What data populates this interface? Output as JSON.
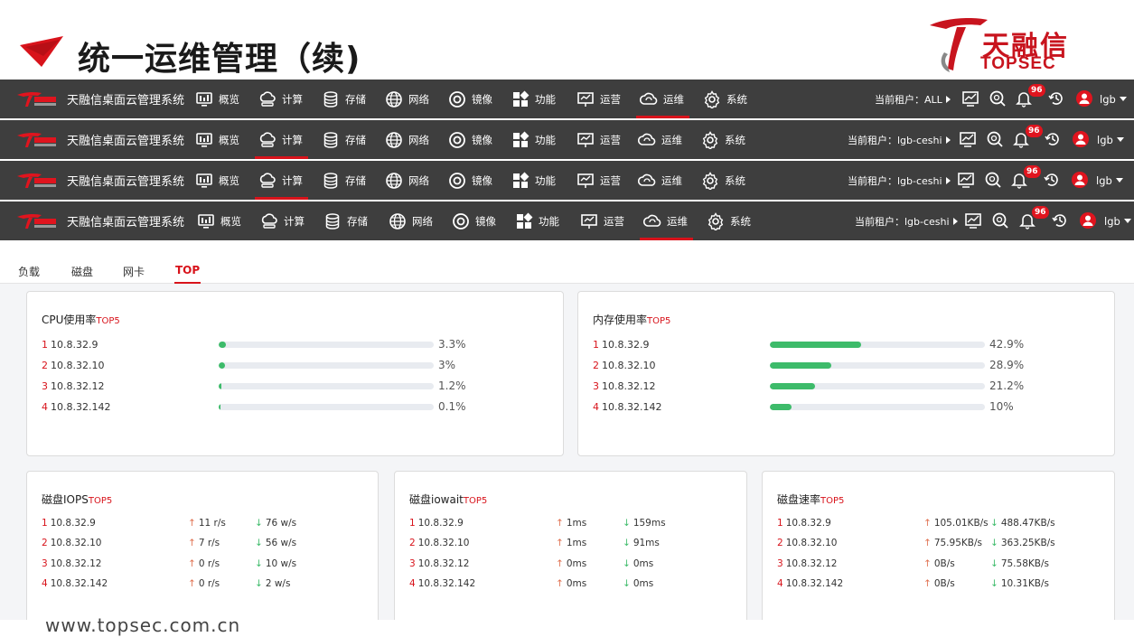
{
  "slide": {
    "title": "统一运维管理（续)",
    "footer_url": "www.topsec.com.cn"
  },
  "logo": {
    "cn": "天融信",
    "en": "TOPSEC"
  },
  "colors": {
    "brand_red": "#d8131b",
    "navbar_bg": "#3e3e3e",
    "bar_green": "#3dbb6a",
    "io_up": "#e07050",
    "io_down": "#3dbb6a"
  },
  "navbars": [
    {
      "brand": "天融信桌面云管理系统",
      "active": "运维",
      "items": [
        {
          "label": "概览",
          "icon": "monitor-icon"
        },
        {
          "label": "计算",
          "icon": "cloud-compute-icon"
        },
        {
          "label": "存储",
          "icon": "database-icon"
        },
        {
          "label": "网络",
          "icon": "globe-icon"
        },
        {
          "label": "镜像",
          "icon": "disc-icon"
        },
        {
          "label": "功能",
          "icon": "grid-icon"
        },
        {
          "label": "运营",
          "icon": "presentation-icon"
        },
        {
          "label": "运维",
          "icon": "cloud-sync-icon"
        },
        {
          "label": "系统",
          "icon": "gear-icon"
        }
      ],
      "tenant": "当前租户：ALL",
      "badge": "96",
      "user": "lgb"
    },
    {
      "brand": "天融信桌面云管理系统",
      "active": "计算",
      "items": [
        {
          "label": "概览",
          "icon": "monitor-icon"
        },
        {
          "label": "计算",
          "icon": "cloud-compute-icon"
        },
        {
          "label": "存储",
          "icon": "database-icon"
        },
        {
          "label": "网络",
          "icon": "globe-icon"
        },
        {
          "label": "镜像",
          "icon": "disc-icon"
        },
        {
          "label": "功能",
          "icon": "grid-icon"
        },
        {
          "label": "运营",
          "icon": "presentation-icon"
        },
        {
          "label": "运维",
          "icon": "cloud-sync-icon"
        },
        {
          "label": "系统",
          "icon": "gear-icon"
        }
      ],
      "tenant": "当前租户：lgb-ceshi",
      "badge": "96",
      "user": "lgb"
    },
    {
      "brand": "天融信桌面云管理系统",
      "active": "计算",
      "items": [
        {
          "label": "概览",
          "icon": "monitor-icon"
        },
        {
          "label": "计算",
          "icon": "cloud-compute-icon"
        },
        {
          "label": "存储",
          "icon": "database-icon"
        },
        {
          "label": "网络",
          "icon": "globe-icon"
        },
        {
          "label": "镜像",
          "icon": "disc-icon"
        },
        {
          "label": "功能",
          "icon": "grid-icon"
        },
        {
          "label": "运营",
          "icon": "presentation-icon"
        },
        {
          "label": "运维",
          "icon": "cloud-sync-icon"
        },
        {
          "label": "系统",
          "icon": "gear-icon"
        }
      ],
      "tenant": "当前租户：lgb-ceshi",
      "badge": "96",
      "user": "lgb"
    },
    {
      "brand": "天融信桌面云管理系统",
      "active": "运维",
      "items": [
        {
          "label": "概览",
          "icon": "monitor-icon"
        },
        {
          "label": "计算",
          "icon": "cloud-compute-icon"
        },
        {
          "label": "存储",
          "icon": "database-icon"
        },
        {
          "label": "网络",
          "icon": "globe-icon"
        },
        {
          "label": "镜像",
          "icon": "disc-icon"
        },
        {
          "label": "功能",
          "icon": "grid-icon"
        },
        {
          "label": "运营",
          "icon": "presentation-icon"
        },
        {
          "label": "运维",
          "icon": "cloud-sync-icon"
        },
        {
          "label": "系统",
          "icon": "gear-icon"
        }
      ],
      "tenant": "当前租户：lgb-ceshi",
      "badge": "96",
      "user": "lgb"
    }
  ],
  "tabs": {
    "items": [
      "负载",
      "磁盘",
      "网卡",
      "TOP"
    ],
    "active": "TOP"
  },
  "cpu": {
    "title": "CPU使用率",
    "suffix": "TOP5",
    "rows": [
      {
        "rank": "1",
        "ip": "10.8.32.9",
        "pct": 3.3,
        "label": "3.3%"
      },
      {
        "rank": "2",
        "ip": "10.8.32.10",
        "pct": 3,
        "label": "3%"
      },
      {
        "rank": "3",
        "ip": "10.8.32.12",
        "pct": 1.2,
        "label": "1.2%"
      },
      {
        "rank": "4",
        "ip": "10.8.32.142",
        "pct": 0.1,
        "label": "0.1%"
      }
    ]
  },
  "mem": {
    "title": "内存使用率",
    "suffix": "TOP5",
    "rows": [
      {
        "rank": "1",
        "ip": "10.8.32.9",
        "pct": 42.9,
        "label": "42.9%"
      },
      {
        "rank": "2",
        "ip": "10.8.32.10",
        "pct": 28.9,
        "label": "28.9%"
      },
      {
        "rank": "3",
        "ip": "10.8.32.12",
        "pct": 21.2,
        "label": "21.2%"
      },
      {
        "rank": "4",
        "ip": "10.8.32.142",
        "pct": 10,
        "label": "10%"
      }
    ]
  },
  "disk_iops": {
    "title": "磁盘IOPS",
    "suffix": "TOP5",
    "rows": [
      {
        "rank": "1",
        "ip": "10.8.32.9",
        "read": "11 r/s",
        "write": "76 w/s"
      },
      {
        "rank": "2",
        "ip": "10.8.32.10",
        "read": "7 r/s",
        "write": "56 w/s"
      },
      {
        "rank": "3",
        "ip": "10.8.32.12",
        "read": "0 r/s",
        "write": "10 w/s"
      },
      {
        "rank": "4",
        "ip": "10.8.32.142",
        "read": "0 r/s",
        "write": "2 w/s"
      }
    ]
  },
  "disk_iowait": {
    "title": "磁盘iowait",
    "suffix": "TOP5",
    "rows": [
      {
        "rank": "1",
        "ip": "10.8.32.9",
        "read": "1ms",
        "write": "159ms"
      },
      {
        "rank": "2",
        "ip": "10.8.32.10",
        "read": "1ms",
        "write": "91ms"
      },
      {
        "rank": "3",
        "ip": "10.8.32.12",
        "read": "0ms",
        "write": "0ms"
      },
      {
        "rank": "4",
        "ip": "10.8.32.142",
        "read": "0ms",
        "write": "0ms"
      }
    ]
  },
  "disk_rate": {
    "title": "磁盘速率",
    "suffix": "TOP5",
    "rows": [
      {
        "rank": "1",
        "ip": "10.8.32.9",
        "read": "105.01KB/s",
        "write": "488.47KB/s"
      },
      {
        "rank": "2",
        "ip": "10.8.32.10",
        "read": "75.95KB/s",
        "write": "363.25KB/s"
      },
      {
        "rank": "3",
        "ip": "10.8.32.12",
        "read": "0B/s",
        "write": "75.58KB/s"
      },
      {
        "rank": "4",
        "ip": "10.8.32.142",
        "read": "0B/s",
        "write": "10.31KB/s"
      }
    ]
  }
}
